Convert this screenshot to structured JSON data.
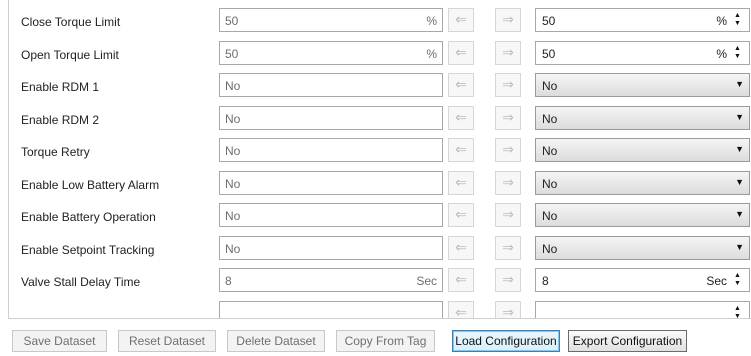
{
  "rows": [
    {
      "label": "Close Torque Limit",
      "current": "50",
      "current_unit": "%",
      "new": "50",
      "new_unit": "%",
      "type": "spin"
    },
    {
      "label": "Open Torque Limit",
      "current": "50",
      "current_unit": "%",
      "new": "50",
      "new_unit": "%",
      "type": "spin"
    },
    {
      "label": "Enable RDM 1",
      "current": "No",
      "current_unit": "",
      "new": "No",
      "new_unit": "",
      "type": "select"
    },
    {
      "label": "Enable RDM 2",
      "current": "No",
      "current_unit": "",
      "new": "No",
      "new_unit": "",
      "type": "select"
    },
    {
      "label": "Torque Retry",
      "current": "No",
      "current_unit": "",
      "new": "No",
      "new_unit": "",
      "type": "select"
    },
    {
      "label": "Enable Low Battery Alarm",
      "current": "No",
      "current_unit": "",
      "new": "No",
      "new_unit": "",
      "type": "select"
    },
    {
      "label": "Enable Battery Operation",
      "current": "No",
      "current_unit": "",
      "new": "No",
      "new_unit": "",
      "type": "select"
    },
    {
      "label": "Enable Setpoint Tracking",
      "current": "No",
      "current_unit": "",
      "new": "No",
      "new_unit": "",
      "type": "select"
    },
    {
      "label": "Valve Stall Delay Time",
      "current": "8",
      "current_unit": "Sec",
      "new": "8",
      "new_unit": "Sec",
      "type": "spin"
    },
    {
      "label": "",
      "current": "",
      "current_unit": "",
      "new": "",
      "new_unit": "",
      "type": "spin"
    }
  ],
  "icons": {
    "copy_left": "arrow-left-icon",
    "copy_right": "arrow-right-icon",
    "spin_up": "caret-up-icon",
    "spin_down": "caret-down-icon",
    "dropdown": "caret-down-icon"
  },
  "buttons": {
    "save_dataset": "Save Dataset",
    "reset_dataset": "Reset Dataset",
    "delete_dataset": "Delete Dataset",
    "copy_from_tag": "Copy From Tag",
    "load_configuration": "Load Configuration",
    "export_configuration": "Export Configuration"
  },
  "colors": {
    "focus_border": "#3c7fb1",
    "disabled_text": "#6f6f6f"
  }
}
